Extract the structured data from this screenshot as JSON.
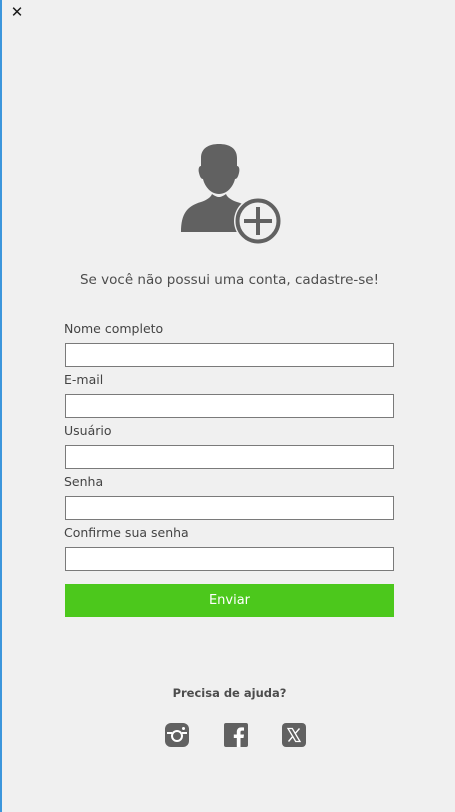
{
  "window": {
    "close_glyph": "✕"
  },
  "header": {
    "icon": "add-user-icon",
    "subtitle": "Se você não possui uma conta, cadastre-se!"
  },
  "form": {
    "fields": [
      {
        "label": "Nome completo",
        "value": ""
      },
      {
        "label": "E-mail",
        "value": ""
      },
      {
        "label": "Usuário",
        "value": ""
      },
      {
        "label": "Senha",
        "value": ""
      },
      {
        "label": "Confirme sua senha",
        "value": ""
      }
    ],
    "submit_label": "Enviar"
  },
  "footer": {
    "help_text": "Precisa de ajuda?",
    "social": [
      "instagram-icon",
      "facebook-icon",
      "x-icon"
    ]
  },
  "colors": {
    "accent": "#4cc81c",
    "icon": "#616161",
    "window_border": "#3c96dc",
    "background": "#f0f0f0"
  }
}
